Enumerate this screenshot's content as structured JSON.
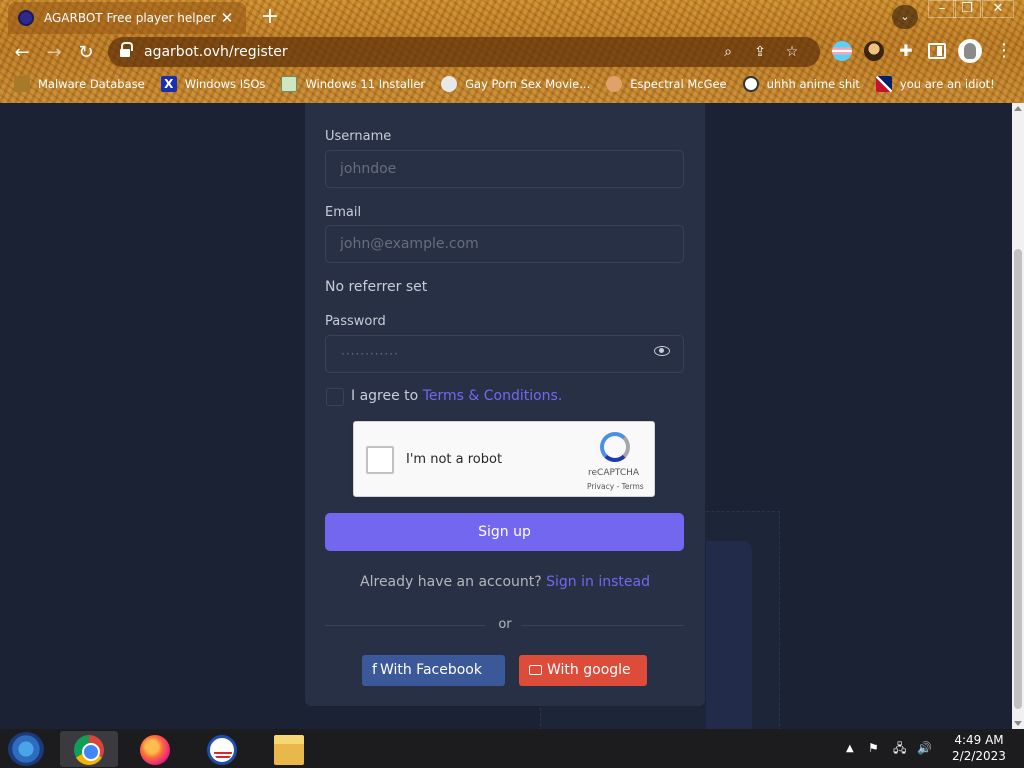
{
  "browser": {
    "tab_title": "AGARBOT Free player helper",
    "url": "agarbot.ovh/register",
    "bookmarks": [
      {
        "label": "Malware Database",
        "icon": "folder-icon"
      },
      {
        "label": "Windows ISOs",
        "icon": "x-icon"
      },
      {
        "label": "Windows 11 Installer",
        "icon": "image-icon"
      },
      {
        "label": "Gay Porn Sex Movie...",
        "icon": "site-icon"
      },
      {
        "label": "Espectral McGee",
        "icon": "face-icon"
      },
      {
        "label": "uhhh anime shit",
        "icon": "anime-icon"
      },
      {
        "label": "you are an idiot!",
        "icon": "uk-flag-icon"
      }
    ]
  },
  "form": {
    "username_label": "Username",
    "username_placeholder": "johndoe",
    "email_label": "Email",
    "email_placeholder": "john@example.com",
    "referrer_text": "No referrer set",
    "password_label": "Password",
    "password_mask": "············",
    "agree_text": "I agree to",
    "terms_link": "Terms & Conditions.",
    "signup_button": "Sign up",
    "already_text": "Already have an account?",
    "signin_link": "Sign in instead",
    "or_text": "or",
    "facebook_button": "With Facebook",
    "google_button": "With google"
  },
  "captcha": {
    "label": "I'm not a robot",
    "brand": "reCAPTCHA",
    "links": "Privacy - Terms"
  },
  "taskbar": {
    "time": "4:49 AM",
    "date": "2/2/2023"
  },
  "colors": {
    "primary": "#7367f0",
    "facebook": "#3b5998",
    "google": "#dd4b39",
    "card_bg": "#283046",
    "page_bg": "#1b2233"
  }
}
